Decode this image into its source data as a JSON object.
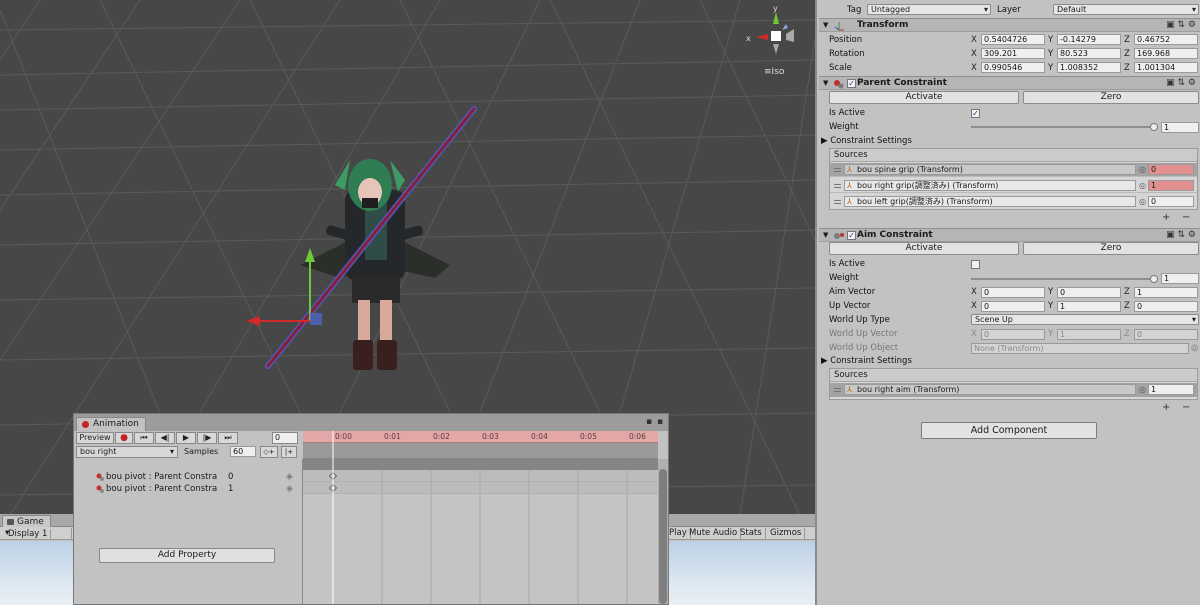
{
  "scene": {
    "projection_label": "Iso",
    "gizmo_axes": {
      "x": "x",
      "y": "y"
    }
  },
  "game": {
    "tab_label": "Game",
    "display_label": "Display 1",
    "toolbar_right": [
      "Play",
      "Mute Audio",
      "Stats",
      "Gizmos"
    ]
  },
  "animation": {
    "tab_label": "Animation",
    "preview_label": "Preview",
    "frame_value": "0",
    "clip_name": "bou right",
    "samples_label": "Samples",
    "samples_value": "60",
    "ruler_ticks": [
      "0:00",
      "0:01",
      "0:02",
      "0:03",
      "0:04",
      "0:05",
      "0:06"
    ],
    "properties": [
      {
        "name": "bou pivot : Parent Constra",
        "value": "0"
      },
      {
        "name": "bou pivot : Parent Constra",
        "value": "1"
      }
    ],
    "add_property_label": "Add Property"
  },
  "inspector": {
    "tag_label": "Tag",
    "tag_value": "Untagged",
    "layer_label": "Layer",
    "layer_value": "Default",
    "transform": {
      "title": "Transform",
      "rows": [
        {
          "label": "Position",
          "x": "0.5404726",
          "y": "-0.14279",
          "z": "0.46752"
        },
        {
          "label": "Rotation",
          "x": "309.201",
          "y": "80.523",
          "z": "169.968"
        },
        {
          "label": "Scale",
          "x": "0.990546",
          "y": "1.008352",
          "z": "1.001304"
        }
      ]
    },
    "parent_constraint": {
      "title": "Parent Constraint",
      "activate_label": "Activate",
      "zero_label": "Zero",
      "is_active_label": "Is Active",
      "is_active": true,
      "weight_label": "Weight",
      "weight_value": "1",
      "weight_fraction": 1.0,
      "constraint_settings_label": "Constraint Settings",
      "sources_label": "Sources",
      "sources": [
        {
          "name": "bou spine grip (Transform)",
          "weight": "0",
          "selected": true,
          "highlight": true
        },
        {
          "name": "bou right grip(調整済み) (Transform)",
          "weight": "1",
          "selected": false,
          "highlight": true
        },
        {
          "name": "bou left grip(調整済み) (Transform)",
          "weight": "0",
          "selected": false,
          "highlight": false
        }
      ]
    },
    "aim_constraint": {
      "title": "Aim Constraint",
      "activate_label": "Activate",
      "zero_label": "Zero",
      "is_active_label": "Is Active",
      "is_active": false,
      "weight_label": "Weight",
      "weight_value": "1",
      "weight_fraction": 1.0,
      "aim_vector_label": "Aim Vector",
      "aim_vector": {
        "x": "0",
        "y": "0",
        "z": "1"
      },
      "up_vector_label": "Up Vector",
      "up_vector": {
        "x": "0",
        "y": "1",
        "z": "0"
      },
      "world_up_type_label": "World Up Type",
      "world_up_type_value": "Scene Up",
      "world_up_vector_label": "World Up Vector",
      "world_up_vector": {
        "x": "0",
        "y": "1",
        "z": "0"
      },
      "world_up_object_label": "World Up Object",
      "world_up_object_value": "None (Transform)",
      "constraint_settings_label": "Constraint Settings",
      "sources_label": "Sources",
      "sources": [
        {
          "name": "bou right aim (Transform)",
          "weight": "1",
          "selected": true
        }
      ]
    },
    "add_component_label": "Add Component"
  },
  "colors": {
    "scene_bg": "#474747",
    "record_red": "#c42323",
    "ruler_red": "#e3a7a7",
    "animated_field_red": "#e39090",
    "staff_line": "#8a1f33",
    "staff_outline": "#4a5bbf"
  }
}
